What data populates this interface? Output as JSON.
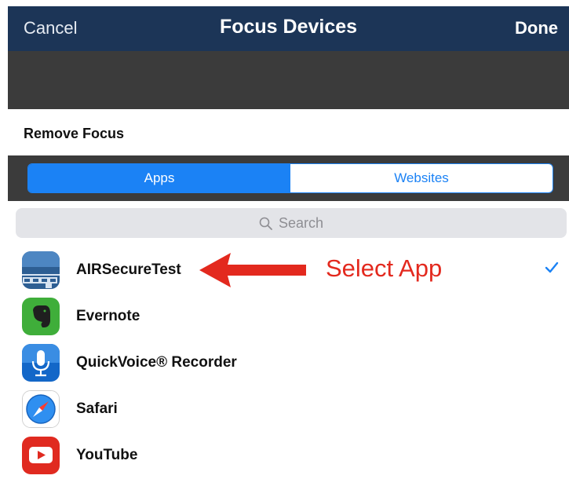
{
  "navbar": {
    "cancel_label": "Cancel",
    "title": "Focus Devices",
    "done_label": "Done"
  },
  "section": {
    "title": "Remove Focus"
  },
  "segmented_control": {
    "apps_label": "Apps",
    "websites_label": "Websites",
    "selected": "Apps"
  },
  "search": {
    "placeholder": "Search"
  },
  "apps": [
    {
      "label": "AIRSecureTest",
      "icon": "airsecuretest-app-icon",
      "selected": true
    },
    {
      "label": "Evernote",
      "icon": "evernote-app-icon",
      "selected": false
    },
    {
      "label": "QuickVoice® Recorder",
      "icon": "quickvoice-app-icon",
      "selected": false
    },
    {
      "label": "Safari",
      "icon": "safari-app-icon",
      "selected": false
    },
    {
      "label": "YouTube",
      "icon": "youtube-app-icon",
      "selected": false
    }
  ],
  "annotation": {
    "text": "Select App",
    "color": "#e3291e"
  },
  "colors": {
    "navbar": "#1c3557",
    "accent": "#1b82f5",
    "band": "#3b3b3b"
  }
}
